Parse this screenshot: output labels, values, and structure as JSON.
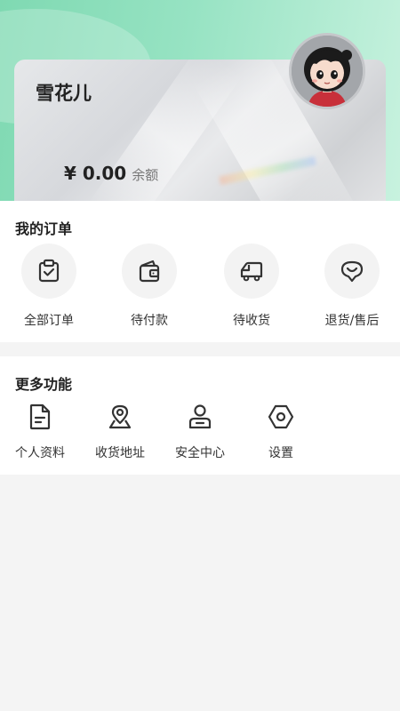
{
  "profile": {
    "username": "雪花儿",
    "balance_amount": "¥ 0.00",
    "balance_label": "余额"
  },
  "orders": {
    "title": "我的订单",
    "items": [
      {
        "label": "全部订单",
        "icon": "clipboard-check-icon"
      },
      {
        "label": "待付款",
        "icon": "wallet-icon"
      },
      {
        "label": "待收货",
        "icon": "truck-icon"
      },
      {
        "label": "退货/售后",
        "icon": "chat-heart-icon"
      }
    ]
  },
  "more": {
    "title": "更多功能",
    "items": [
      {
        "label": "个人资料",
        "icon": "document-icon"
      },
      {
        "label": "收货地址",
        "icon": "location-pin-icon"
      },
      {
        "label": "安全中心",
        "icon": "user-shield-icon"
      },
      {
        "label": "设置",
        "icon": "settings-hexagon-icon"
      }
    ]
  },
  "colors": {
    "header_gradient_start": "#7fd9b2",
    "header_gradient_end": "#c8f2df",
    "page_background": "#f4f4f4",
    "icon_stroke": "#333333"
  }
}
